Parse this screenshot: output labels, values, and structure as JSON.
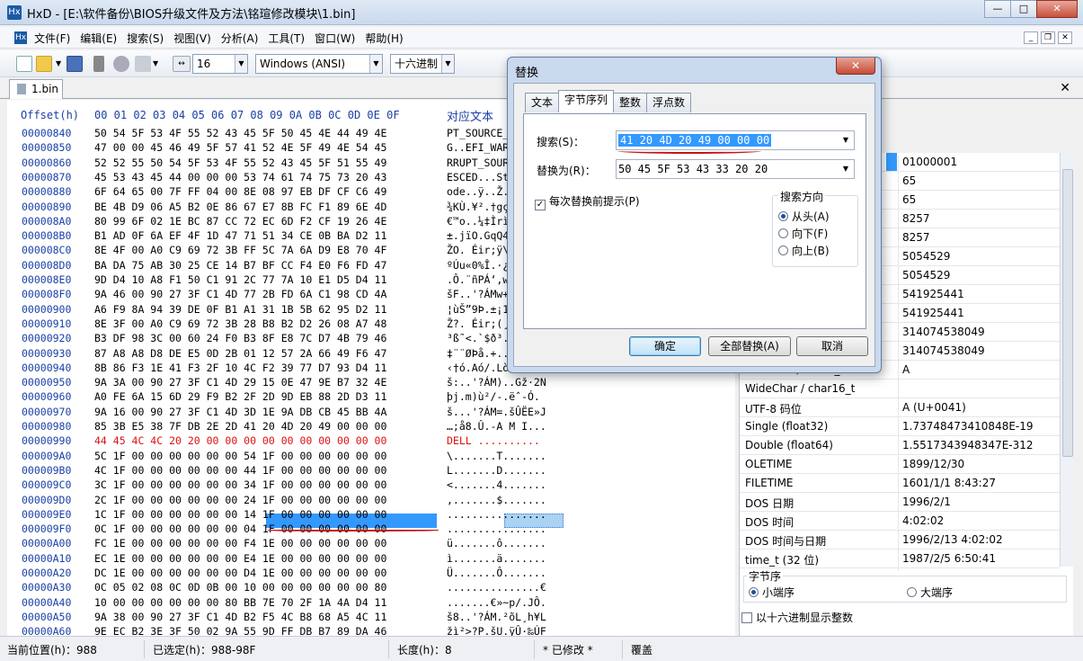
{
  "window": {
    "app_icon": "Hx",
    "title": "HxD - [E:\\软件备份\\BIOS升级文件及方法\\铭瑄修改模块\\1.bin]",
    "min": "—",
    "max": "□",
    "close": "✕"
  },
  "menu": {
    "items": [
      "文件(F)",
      "编辑(E)",
      "搜索(S)",
      "视图(V)",
      "分析(A)",
      "工具(T)",
      "窗口(W)",
      "帮助(H)"
    ],
    "mdi_min": "_",
    "mdi_restore": "❐",
    "mdi_close": "✕"
  },
  "toolbar": {
    "bytes_per_row": "16",
    "charset": "Windows (ANSI)",
    "offset_base": "十六进制"
  },
  "doc": {
    "tab_label": "1.bin",
    "close": "✕"
  },
  "hex": {
    "header_offset": "Offset(h)",
    "header_cols": "00 01 02 03 04 05 06 07 08 09 0A 0B 0C 0D 0E 0F",
    "header_text": "对应文本",
    "rows": [
      {
        "off": "00000840",
        "bytes": "50 54 5F 53 4F 55 52 43 45 5F 50 45 4E 44 49 4E",
        "txt": "PT_SOURCE_PENDIN"
      },
      {
        "off": "00000850",
        "bytes": "47 00 00 45 46 49 5F 57 41 52 4E 5F 49 4E 54 45",
        "txt": "G..EFI_WARN_INTE"
      },
      {
        "off": "00000860",
        "bytes": "52 52 55 50 54 5F 53 4F 55 52 43 45 5F 51 55 49",
        "txt": "RRUPT_SOURCE_QUI"
      },
      {
        "off": "00000870",
        "bytes": "45 53 43 45 44 00 00 00 53 74 61 74 75 73 20 43",
        "txt": "ESCED...Status C"
      },
      {
        "off": "00000880",
        "bytes": "6F 64 65 00 7F FF 04 00 8E 08 97 EB DF CF C6 49",
        "txt": "ode..ÿ..Ž.—ëßÏÆI"
      },
      {
        "off": "00000890",
        "bytes": "BE 4B D9 06 A5 B2 0E 86 67 E7 8B FC F1 89 6E 4D",
        "txt": "¾KÙ.¥².†gç‹üñ‰nM"
      },
      {
        "off": "000008A0",
        "bytes": "80 99 6F 02 1E BC 87 CC 72 EC 6D F2 CF 19 26 4E",
        "txt": "€™o..¼‡ÌrìmòÏ.&N"
      },
      {
        "off": "000008B0",
        "bytes": "B1 AD 0F 6A EF 4F 1D 47 71 51 34 CE 0B BA D2 11",
        "txt": "±­.jïO.GqQ4Î.ºÒ."
      },
      {
        "off": "000008C0",
        "bytes": "8E 4F 00 A0 C9 69 72 3B FF 5C 7A 6A D9 E8 70 4F",
        "txt": "ŽO. Éir;ÿ\\zjÙèpO"
      },
      {
        "off": "000008D0",
        "bytes": "BA DA 75 AB 30 25 CE 14 B7 BF CC F4 E0 F6 FD 47",
        "txt": "ºÚu«0%Î.·¿ÌôàöýG"
      },
      {
        "off": "000008E0",
        "bytes": "9D D4 10 A8 F1 50 C1 91 2C 77 7A 10 E1 D5 D4 11",
        "txt": ".Ô.¨ñPÁ‘,wz.áÕÔ."
      },
      {
        "off": "000008F0",
        "bytes": "9A 46 00 90 27 3F C1 4D 77 2B FD 6A C1 98 CD 4A",
        "txt": "šF..'?ÁMw+ýjÁ˜ÍJ"
      },
      {
        "off": "00000900",
        "bytes": "A6 F9 8A 94 39 DE 0F B1 A1 31 1B 5B 62 95 D2 11",
        "txt": "¦ùŠ”9Þ.±¡1.[b•Ò."
      },
      {
        "off": "00000910",
        "bytes": "8E 3F 00 A0 C9 69 72 3B 28 B8 B2 D2 26 08 A7 48",
        "txt": "Ž?. Éir;(¸²Ò&.§H"
      },
      {
        "off": "00000920",
        "bytes": "B3 DF 98 3C 00 60 24 F0 B3 8F E8 7C D7 4B 79 46",
        "txt": "³ß˜<.`$ð³.è|×KyF"
      },
      {
        "off": "00000930",
        "bytes": "87 A8 A8 D8 DE E5 0D 2B 01 12 57 2A 66 49 F6 47",
        "txt": "‡¨¨ØÞå.+..W*fIöG"
      },
      {
        "off": "00000940",
        "bytes": "8B 86 F3 1E 41 F3 2F 10 4C F2 39 77 D7 93 D4 11",
        "txt": "‹†ó.Aó/.Lò9w×“Ô."
      },
      {
        "off": "00000950",
        "bytes": "9A 3A 00 90 27 3F C1 4D 29 15 0E 47 9E B7 32 4E",
        "txt": "š:..'?ÁM)..Gž·2N"
      },
      {
        "off": "00000960",
        "bytes": "A0 FE 6A 15 6D 29 F9 B2 2F 2D 9D EB 88 2D D3 11",
        "txt": " þj.m)ù²/-.ëˆ-Ó."
      },
      {
        "off": "00000970",
        "bytes": "9A 16 00 90 27 3F C1 4D 3D 1E 9A DB CB 45 BB 4A",
        "txt": "š...'?ÁM=.šÛËE»J"
      },
      {
        "off": "00000980",
        "bytes": "85 3B E5 38 7F DB 2E 2D 41 20 4D 20 49 00 00 00",
        "txt": "…;å8.Û.-A M I..."
      },
      {
        "off": "00000990",
        "bytes": "44 45 4C 4C 20 20 00 00 00 00 00 00 00 00 00 00",
        "txt": "DELL  .........."
      },
      {
        "off": "000009A0",
        "bytes": "5C 1F 00 00 00 00 00 00 54 1F 00 00 00 00 00 00",
        "txt": "\\.......T......."
      },
      {
        "off": "000009B0",
        "bytes": "4C 1F 00 00 00 00 00 00 44 1F 00 00 00 00 00 00",
        "txt": "L.......D......."
      },
      {
        "off": "000009C0",
        "bytes": "3C 1F 00 00 00 00 00 00 34 1F 00 00 00 00 00 00",
        "txt": "<.......4......."
      },
      {
        "off": "000009D0",
        "bytes": "2C 1F 00 00 00 00 00 00 24 1F 00 00 00 00 00 00",
        "txt": ",.......$......."
      },
      {
        "off": "000009E0",
        "bytes": "1C 1F 00 00 00 00 00 00 14 1F 00 00 00 00 00 00",
        "txt": "................"
      },
      {
        "off": "000009F0",
        "bytes": "0C 1F 00 00 00 00 00 00 04 1F 00 00 00 00 00 00",
        "txt": "................"
      },
      {
        "off": "00000A00",
        "bytes": "FC 1E 00 00 00 00 00 00 F4 1E 00 00 00 00 00 00",
        "txt": "ü.......ô......."
      },
      {
        "off": "00000A10",
        "bytes": "EC 1E 00 00 00 00 00 00 E4 1E 00 00 00 00 00 00",
        "txt": "ì.......ä......."
      },
      {
        "off": "00000A20",
        "bytes": "DC 1E 00 00 00 00 00 00 D4 1E 00 00 00 00 00 00",
        "txt": "Ü.......Ô......."
      },
      {
        "off": "00000A30",
        "bytes": "0C 05 02 08 0C 0D 0B 00 10 00 00 00 00 00 00 80",
        "txt": "...............€"
      },
      {
        "off": "00000A40",
        "bytes": "10 00 00 00 00 00 00 80 BB 7E 70 2F 1A 4A D4 11",
        "txt": ".......€»~p/.JÔ."
      },
      {
        "off": "00000A50",
        "bytes": "9A 38 00 90 27 3F C1 4D B2 F5 4C B8 68 A5 4C 11",
        "txt": "š8..'?ÁM.²õL¸h¥L"
      },
      {
        "off": "00000A60",
        "bytes": "9E EC B2 3E 3F 50 02 9A 55 9D FF DB B7 89 DA 46",
        "txt": "žì²>?P.šU.ÿÛ·‰ÚF"
      }
    ]
  },
  "inspector": {
    "rows": [
      {
        "k": "",
        "v": "01000001",
        "sel": true
      },
      {
        "k": "",
        "v": "65"
      },
      {
        "k": "",
        "v": "65"
      },
      {
        "k": "",
        "v": "8257"
      },
      {
        "k": "",
        "v": "8257"
      },
      {
        "k": "",
        "v": "5054529"
      },
      {
        "k": "",
        "v": "5054529"
      },
      {
        "k": "",
        "v": "541925441"
      },
      {
        "k": "",
        "v": "541925441"
      },
      {
        "k": "",
        "v": "314074538049"
      },
      {
        "k": "",
        "v": "314074538049"
      },
      {
        "k": "AnsiChar / char8_t",
        "v": "A"
      },
      {
        "k": "WideChar / char16_t",
        "v": " "
      },
      {
        "k": "UTF-8 码位",
        "v": "A (U+0041)"
      },
      {
        "k": "Single (float32)",
        "v": "1.73748473410848E-19"
      },
      {
        "k": "Double (float64)",
        "v": "1.5517343948347E-312"
      },
      {
        "k": "OLETIME",
        "v": "1899/12/30"
      },
      {
        "k": "FILETIME",
        "v": "1601/1/1 8:43:27"
      },
      {
        "k": "DOS 日期",
        "v": "1996/2/1"
      },
      {
        "k": "DOS 时间",
        "v": "4:02:02"
      },
      {
        "k": "DOS 时间与日期",
        "v": "1996/2/13 4:02:02"
      },
      {
        "k": "time_t (32 位)",
        "v": "1987/2/5 6:50:41"
      }
    ],
    "byte_order_label": "字节序",
    "little_endian": "小端序",
    "big_endian": "大端序",
    "hex_ints_label": "以十六进制显示整数"
  },
  "status": {
    "position": "当前位置(h)：988",
    "selected": "已选定(h)：988-98F",
    "length": "长度(h)：8",
    "modified": "* 已修改 *",
    "mode": "覆盖"
  },
  "dialog": {
    "title": "替换",
    "close": "✕",
    "tabs": [
      "文本",
      "字节序列",
      "整数",
      "浮点数"
    ],
    "search_label": "搜索(S)：",
    "search_value": "41 20 4D 20 49 00 00 00",
    "replace_label": "替换为(R)：",
    "replace_value": "50 45 5F 53 43 33 20 20",
    "prompt_label": "每次替换前提示(P)",
    "check_mark": "✓",
    "direction_label": "搜索方向",
    "dir_all": "从头(A)",
    "dir_down": "向下(F)",
    "dir_up": "向上(B)",
    "ok": "确定",
    "replace_all": "全部替换(A)",
    "cancel": "取消"
  }
}
